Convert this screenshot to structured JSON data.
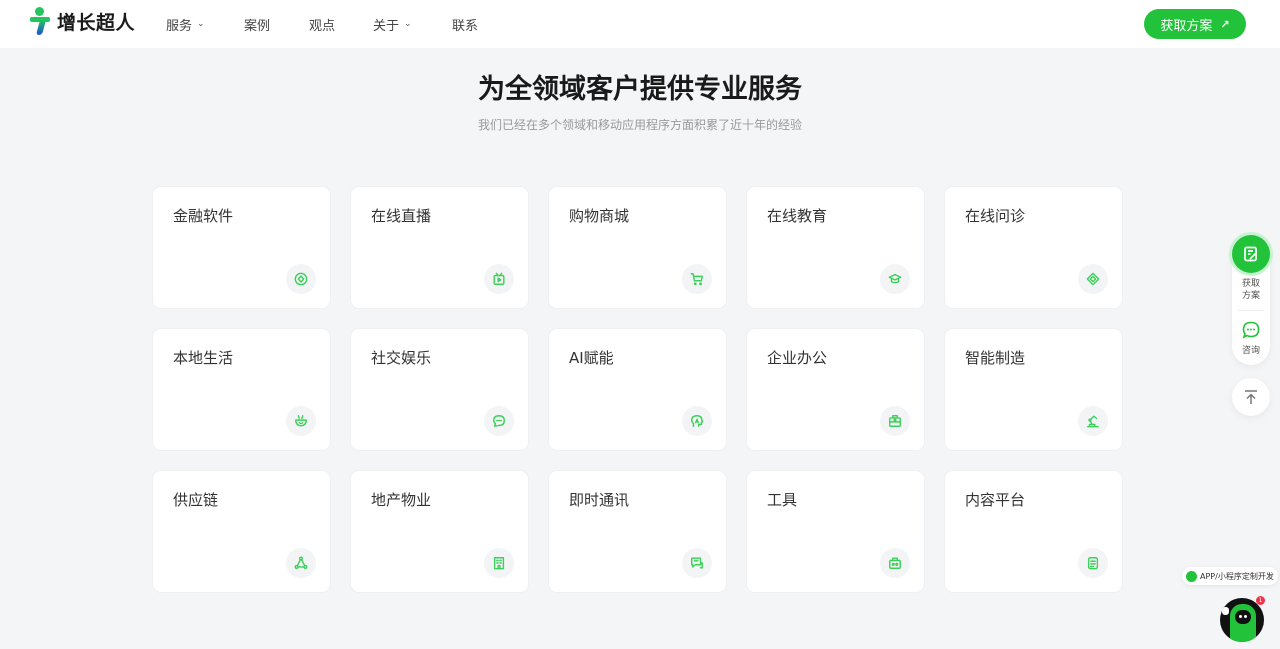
{
  "header": {
    "logo_text": "增长超人",
    "nav": [
      {
        "label": "服务",
        "has_dropdown": true
      },
      {
        "label": "案例",
        "has_dropdown": false
      },
      {
        "label": "观点",
        "has_dropdown": false
      },
      {
        "label": "关于",
        "has_dropdown": true
      },
      {
        "label": "联系",
        "has_dropdown": false
      }
    ],
    "cta_label": "获取方案",
    "cta_icon": "arrow-up-right-icon"
  },
  "hero": {
    "title": "为全领域客户提供专业服务",
    "subtitle": "我们已经在多个领域和移动应用程序方面积累了近十年的经验"
  },
  "industries": [
    {
      "label": "金融软件",
      "icon": "coin-icon"
    },
    {
      "label": "在线直播",
      "icon": "tv-play-icon"
    },
    {
      "label": "购物商城",
      "icon": "cart-icon"
    },
    {
      "label": "在线教育",
      "icon": "graduation-cap-icon"
    },
    {
      "label": "在线问诊",
      "icon": "diamond-icon"
    },
    {
      "label": "本地生活",
      "icon": "bowl-icon"
    },
    {
      "label": "社交娱乐",
      "icon": "chat-bubbles-icon"
    },
    {
      "label": "AI赋能",
      "icon": "ai-head-icon"
    },
    {
      "label": "企业办公",
      "icon": "briefcase-icon"
    },
    {
      "label": "智能制造",
      "icon": "robot-arm-icon"
    },
    {
      "label": "供应链",
      "icon": "network-icon"
    },
    {
      "label": "地产物业",
      "icon": "building-icon"
    },
    {
      "label": "即时通讯",
      "icon": "message-icon"
    },
    {
      "label": "工具",
      "icon": "toolbox-icon"
    },
    {
      "label": "内容平台",
      "icon": "document-icon"
    }
  ],
  "side_panel": {
    "quote_label_1": "获取",
    "quote_label_2": "方案",
    "consult_label": "咨询"
  },
  "chat_widget": {
    "bubble_text": "APP/小程序定制开发",
    "badge_count": "1"
  },
  "colors": {
    "brand_green": "#22c33a",
    "icon_green": "#3ccf5a",
    "background": "#f4f5f7"
  }
}
